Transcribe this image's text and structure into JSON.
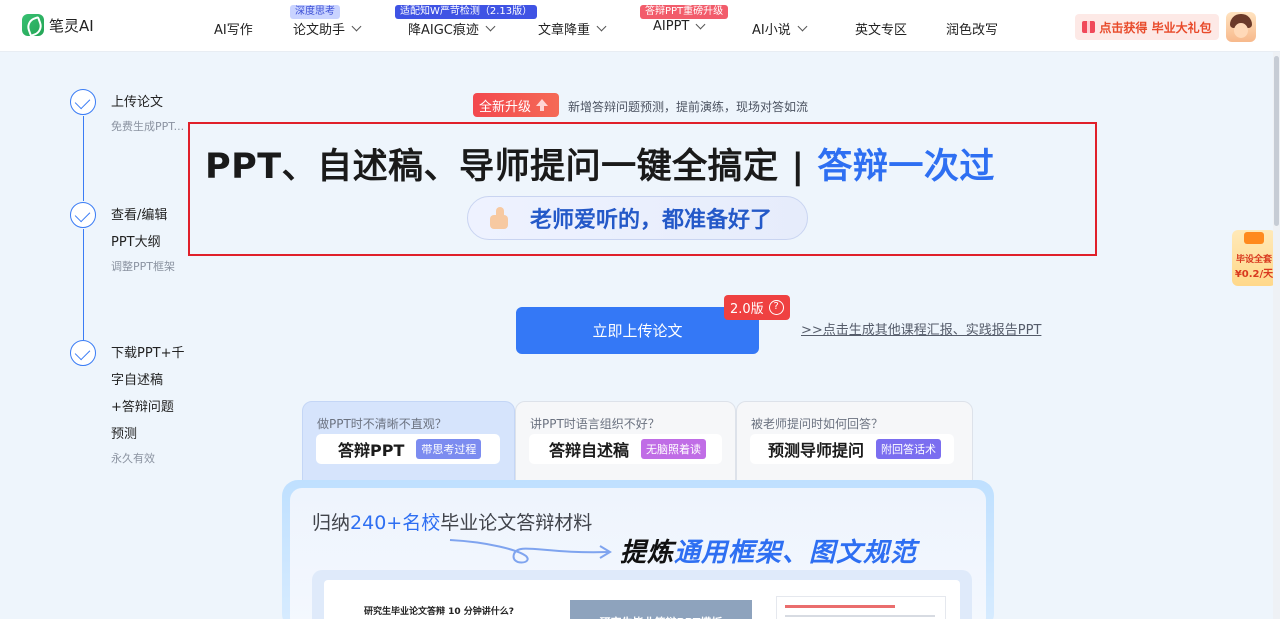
{
  "brand": {
    "name": "笔灵AI"
  },
  "nav": {
    "items": [
      {
        "label": "AI写作"
      },
      {
        "label": "论文助手",
        "badge": "深度思考"
      },
      {
        "label": "降AIGC痕迹",
        "badge": "适配知W严苛检测（2.13版）"
      },
      {
        "label": "文章降重"
      },
      {
        "label": "AIPPT",
        "badge": "答辩PPT重磅升级"
      },
      {
        "label": "AI小说"
      },
      {
        "label": "英文专区"
      },
      {
        "label": "润色改写"
      }
    ],
    "gift_label": "点击获得 毕业大礼包"
  },
  "steps": [
    {
      "title_lines": [
        "上传论文"
      ],
      "sub": "免费生成PPT..."
    },
    {
      "title_lines": [
        "查看/编辑",
        "PPT大纲"
      ],
      "sub": "调整PPT框架"
    },
    {
      "title_lines": [
        "下载PPT+千",
        "字自述稿",
        "+答辩问题",
        "预测"
      ],
      "sub": "永久有效"
    }
  ],
  "hero": {
    "upgrade_tag": "全新升级",
    "upgrade_note": "新增答辩问题预测，提前演练，现场对答如流",
    "headline_main": "PPT、自述稿、导师提问一键全搞定 | ",
    "headline_accent": "答辩一次过",
    "pill_text": "老师爱听的，都准备好了"
  },
  "cta": {
    "upload_label": "立即上传论文",
    "version_tag": "2.0版",
    "version_help": "?",
    "other_link": ">>点击生成其他课程汇报、实践报告PPT"
  },
  "features": [
    {
      "question": "做PPT时不清晰不直观？",
      "title": "答辩PPT",
      "tag": "带思考过程",
      "tag_color": "#7c8cf0"
    },
    {
      "question": "讲PPT时语言组织不好？",
      "title": "答辩自述稿",
      "tag": "无脑照着读",
      "tag_color": "#c06de6"
    },
    {
      "question": "被老师提问时如何回答？",
      "title": "预测导师提问",
      "tag": "附回答话术",
      "tag_color": "#7b6ef0"
    }
  ],
  "showcase": {
    "summary_pre": "归纳",
    "summary_num": "240+名校",
    "summary_post": "毕业论文答辩材料",
    "extract_pre": "提炼",
    "extract_accent": "通用框架、图文规范",
    "doc_title": "研究生毕业论文答辩 10 分钟讲什么?",
    "slide_title": "研究生毕业答辩PPT模板"
  },
  "float_promo": {
    "line1": "毕设全套",
    "line2": "¥0.2/天"
  },
  "colors": {
    "accent": "#3478f6",
    "highlight_border": "#e0202a",
    "badge_red": "#ef4141"
  }
}
